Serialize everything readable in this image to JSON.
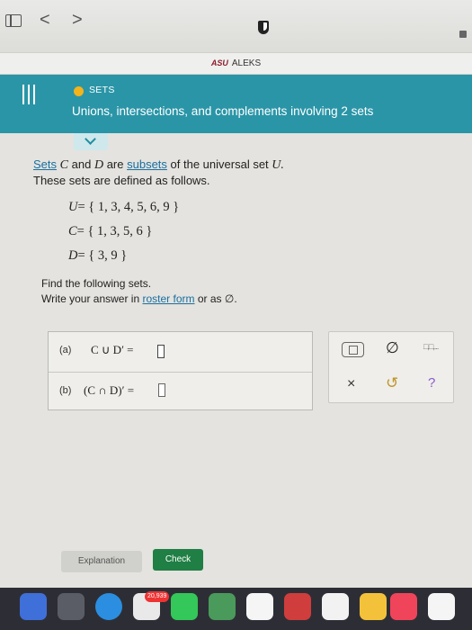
{
  "browser": {
    "back_glyph": "<",
    "forward_glyph": ">",
    "tab_brand": "ASU",
    "tab_title": "ALEKS"
  },
  "header": {
    "topic": "SETS",
    "topic_dot_color": "#f3b31b",
    "subtopic": "Unions, intersections, and complements involving 2 sets",
    "bg_color": "#2a95a7"
  },
  "problem": {
    "line1_link1": "Sets",
    "var_c": "C",
    "and_word": "and",
    "var_d": "D",
    "are_word": "are",
    "line1_link2": "subsets",
    "line1_tail": "of the universal set",
    "var_u": "U.",
    "line2": "These sets are defined as follows.",
    "sets": [
      {
        "name": "U",
        "elements": "= { 1, 3, 4, 5, 6, 9 }"
      },
      {
        "name": "C",
        "elements": "= { 1, 3, 5, 6 }"
      },
      {
        "name": "D",
        "elements": "= { 3, 9 }"
      }
    ],
    "find_line": "Find the following sets.",
    "write_prefix": "Write your answer in",
    "write_link": "roster form",
    "write_suffix": "or as ∅."
  },
  "answers": {
    "a_label": "(a)",
    "a_expr": "C ∪ D′ =",
    "b_label": "(b)",
    "b_expr": "(C ∩ D)′ =",
    "a_value": "",
    "b_value": ""
  },
  "tools": {
    "braces_icon": "set-braces-icon",
    "empty_set_symbol": "∅",
    "more_symbols": "□,□,...",
    "clear_symbol": "×",
    "undo_symbol": "↺",
    "help_symbol": "?"
  },
  "buttons": {
    "explanation": "Explanation",
    "check": "Check",
    "check_color": "#1f7f44"
  },
  "dock": {
    "badge": "20,939"
  }
}
